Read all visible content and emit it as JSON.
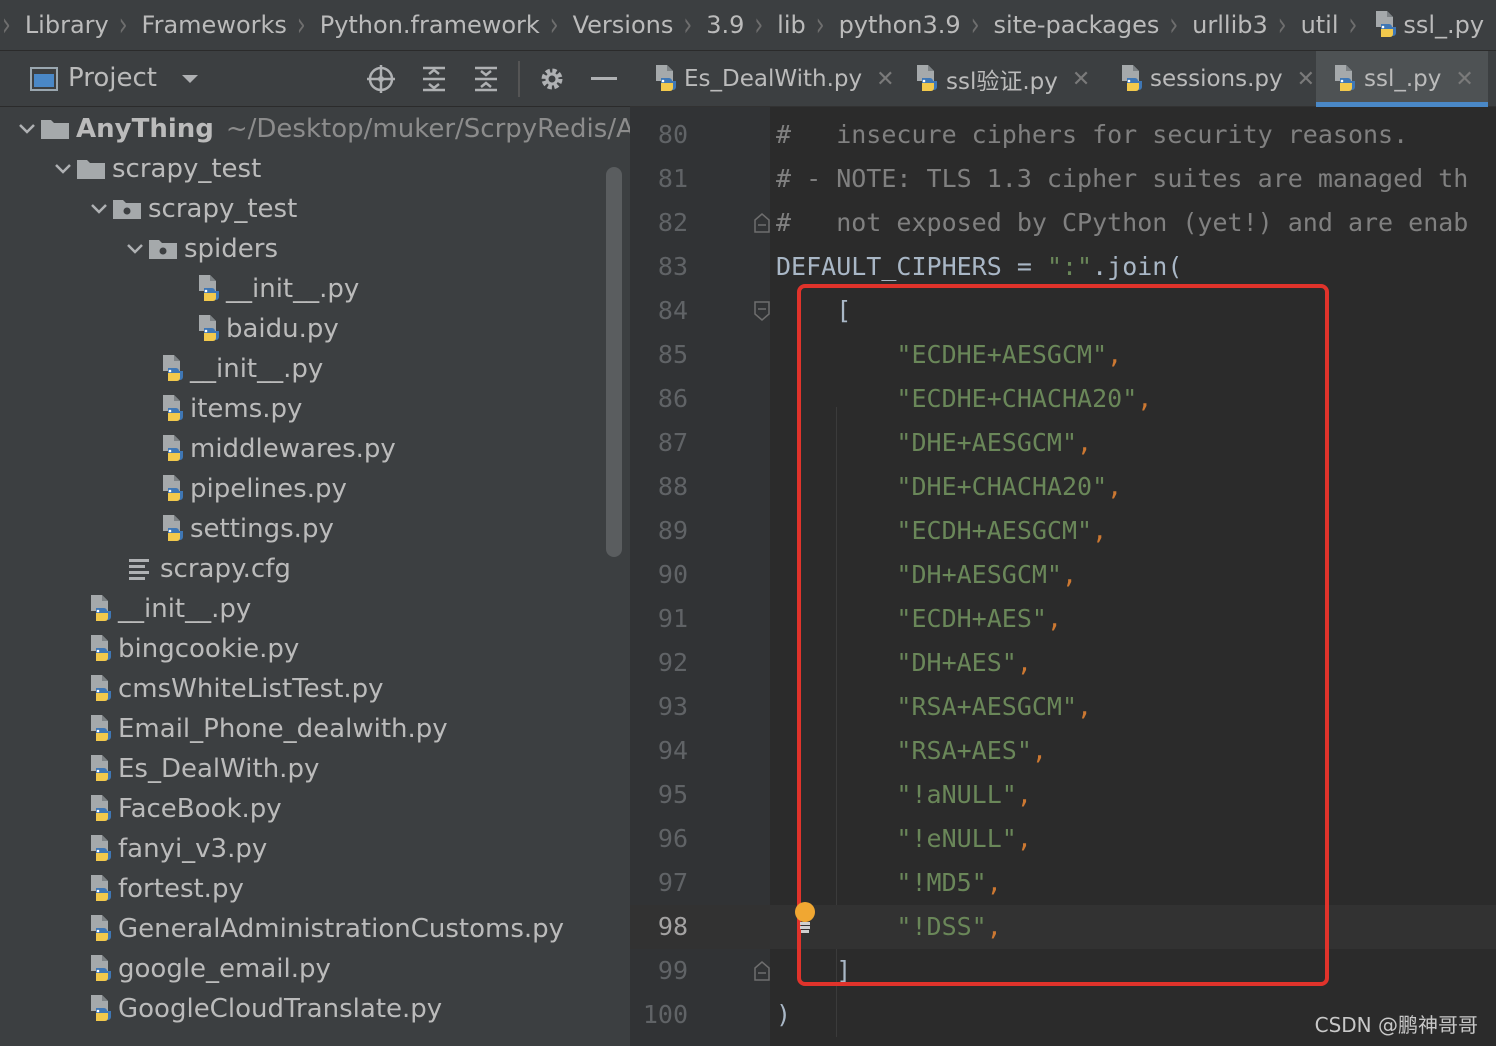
{
  "breadcrumb": {
    "items": [
      "Library",
      "Frameworks",
      "Python.framework",
      "Versions",
      "3.9",
      "lib",
      "python3.9",
      "site-packages",
      "urllib3",
      "util",
      "ssl_.py"
    ]
  },
  "project_panel": {
    "title": "Project",
    "icons": [
      "project-view-icon",
      "chevron-down-icon",
      "locate-icon",
      "expand-all-icon",
      "collapse-all-icon",
      "gear-icon",
      "minimize-icon"
    ]
  },
  "tree": {
    "root": {
      "name": "AnyThing",
      "path": "~/Desktop/muker/ScrpyRedis/A"
    },
    "items": [
      {
        "label": "scrapy_test",
        "type": "folder",
        "expanded": true
      },
      {
        "label": "scrapy_test",
        "type": "package",
        "expanded": true
      },
      {
        "label": "spiders",
        "type": "package",
        "expanded": true
      },
      {
        "label": "__init__.py",
        "type": "py"
      },
      {
        "label": "baidu.py",
        "type": "py"
      },
      {
        "label": "__init__.py",
        "type": "py"
      },
      {
        "label": "items.py",
        "type": "py"
      },
      {
        "label": "middlewares.py",
        "type": "py"
      },
      {
        "label": "pipelines.py",
        "type": "py"
      },
      {
        "label": "settings.py",
        "type": "py"
      },
      {
        "label": "scrapy.cfg",
        "type": "cfg"
      },
      {
        "label": "__init__.py",
        "type": "py"
      },
      {
        "label": "bingcookie.py",
        "type": "py"
      },
      {
        "label": "cmsWhiteListTest.py",
        "type": "py"
      },
      {
        "label": "Email_Phone_dealwith.py",
        "type": "py"
      },
      {
        "label": "Es_DealWith.py",
        "type": "py"
      },
      {
        "label": "FaceBook.py",
        "type": "py"
      },
      {
        "label": "fanyi_v3.py",
        "type": "py"
      },
      {
        "label": "fortest.py",
        "type": "py"
      },
      {
        "label": "GeneralAdministrationCustoms.py",
        "type": "py"
      },
      {
        "label": "google_email.py",
        "type": "py"
      },
      {
        "label": "GoogleCloudTranslate.py",
        "type": "py"
      }
    ]
  },
  "tabs": [
    {
      "label": "Es_DealWith.py",
      "active": false
    },
    {
      "label": "ssl验证.py",
      "active": false
    },
    {
      "label": "sessions.py",
      "active": false
    },
    {
      "label": "ssl_.py",
      "active": true
    }
  ],
  "code": {
    "current_line": "98",
    "lines": [
      {
        "num": "80",
        "segments": [
          {
            "t": "#   insecure ciphers for security reasons.",
            "c": "comment"
          }
        ]
      },
      {
        "num": "81",
        "segments": [
          {
            "t": "# - NOTE: TLS 1.3 cipher suites are managed th",
            "c": "comment"
          }
        ]
      },
      {
        "num": "82",
        "segments": [
          {
            "t": "#   not exposed by CPython (yet!) and are enab",
            "c": "comment"
          }
        ]
      },
      {
        "num": "83",
        "segments": [
          {
            "t": "DEFAULT_CIPHERS",
            "c": "ident"
          },
          {
            "t": " = ",
            "c": "plain"
          },
          {
            "t": "\":\"",
            "c": "string"
          },
          {
            "t": ".join(",
            "c": "plain"
          }
        ]
      },
      {
        "num": "84",
        "segments": [
          {
            "t": "    [",
            "c": "plain"
          }
        ]
      },
      {
        "num": "85",
        "segments": [
          {
            "t": "        ",
            "c": "plain"
          },
          {
            "t": "\"ECDHE+AESGCM\"",
            "c": "string"
          },
          {
            "t": ",",
            "c": "op"
          }
        ]
      },
      {
        "num": "86",
        "segments": [
          {
            "t": "        ",
            "c": "plain"
          },
          {
            "t": "\"ECDHE+CHACHA20\"",
            "c": "string"
          },
          {
            "t": ",",
            "c": "op"
          }
        ]
      },
      {
        "num": "87",
        "segments": [
          {
            "t": "        ",
            "c": "plain"
          },
          {
            "t": "\"DHE+AESGCM\"",
            "c": "string"
          },
          {
            "t": ",",
            "c": "op"
          }
        ]
      },
      {
        "num": "88",
        "segments": [
          {
            "t": "        ",
            "c": "plain"
          },
          {
            "t": "\"DHE+CHACHA20\"",
            "c": "string"
          },
          {
            "t": ",",
            "c": "op"
          }
        ]
      },
      {
        "num": "89",
        "segments": [
          {
            "t": "        ",
            "c": "plain"
          },
          {
            "t": "\"ECDH+AESGCM\"",
            "c": "string"
          },
          {
            "t": ",",
            "c": "op"
          }
        ]
      },
      {
        "num": "90",
        "segments": [
          {
            "t": "        ",
            "c": "plain"
          },
          {
            "t": "\"DH+AESGCM\"",
            "c": "string"
          },
          {
            "t": ",",
            "c": "op"
          }
        ]
      },
      {
        "num": "91",
        "segments": [
          {
            "t": "        ",
            "c": "plain"
          },
          {
            "t": "\"ECDH+AES\"",
            "c": "string"
          },
          {
            "t": ",",
            "c": "op"
          }
        ]
      },
      {
        "num": "92",
        "segments": [
          {
            "t": "        ",
            "c": "plain"
          },
          {
            "t": "\"DH+AES\"",
            "c": "string"
          },
          {
            "t": ",",
            "c": "op"
          }
        ]
      },
      {
        "num": "93",
        "segments": [
          {
            "t": "        ",
            "c": "plain"
          },
          {
            "t": "\"RSA+AESGCM\"",
            "c": "string"
          },
          {
            "t": ",",
            "c": "op"
          }
        ]
      },
      {
        "num": "94",
        "segments": [
          {
            "t": "        ",
            "c": "plain"
          },
          {
            "t": "\"RSA+AES\"",
            "c": "string"
          },
          {
            "t": ",",
            "c": "op"
          }
        ]
      },
      {
        "num": "95",
        "segments": [
          {
            "t": "        ",
            "c": "plain"
          },
          {
            "t": "\"!aNULL\"",
            "c": "string"
          },
          {
            "t": ",",
            "c": "op"
          }
        ]
      },
      {
        "num": "96",
        "segments": [
          {
            "t": "        ",
            "c": "plain"
          },
          {
            "t": "\"!eNULL\"",
            "c": "string"
          },
          {
            "t": ",",
            "c": "op"
          }
        ]
      },
      {
        "num": "97",
        "segments": [
          {
            "t": "        ",
            "c": "plain"
          },
          {
            "t": "\"!MD5\"",
            "c": "string"
          },
          {
            "t": ",",
            "c": "op"
          }
        ]
      },
      {
        "num": "98",
        "segments": [
          {
            "t": "        ",
            "c": "plain"
          },
          {
            "t": "\"!DSS\"",
            "c": "string"
          },
          {
            "t": ",",
            "c": "op"
          }
        ]
      },
      {
        "num": "99",
        "segments": [
          {
            "t": "    ]",
            "c": "plain"
          }
        ]
      },
      {
        "num": "100",
        "segments": [
          {
            "t": ")",
            "c": "plain"
          }
        ]
      }
    ]
  },
  "watermark": "CSDN @鹏神哥哥",
  "colors": {
    "highlight_box": "#e0332b",
    "active_tab_underline": "#4a88c7",
    "string": "#6a8759",
    "comment": "#808080",
    "keyword": "#cc7832"
  }
}
